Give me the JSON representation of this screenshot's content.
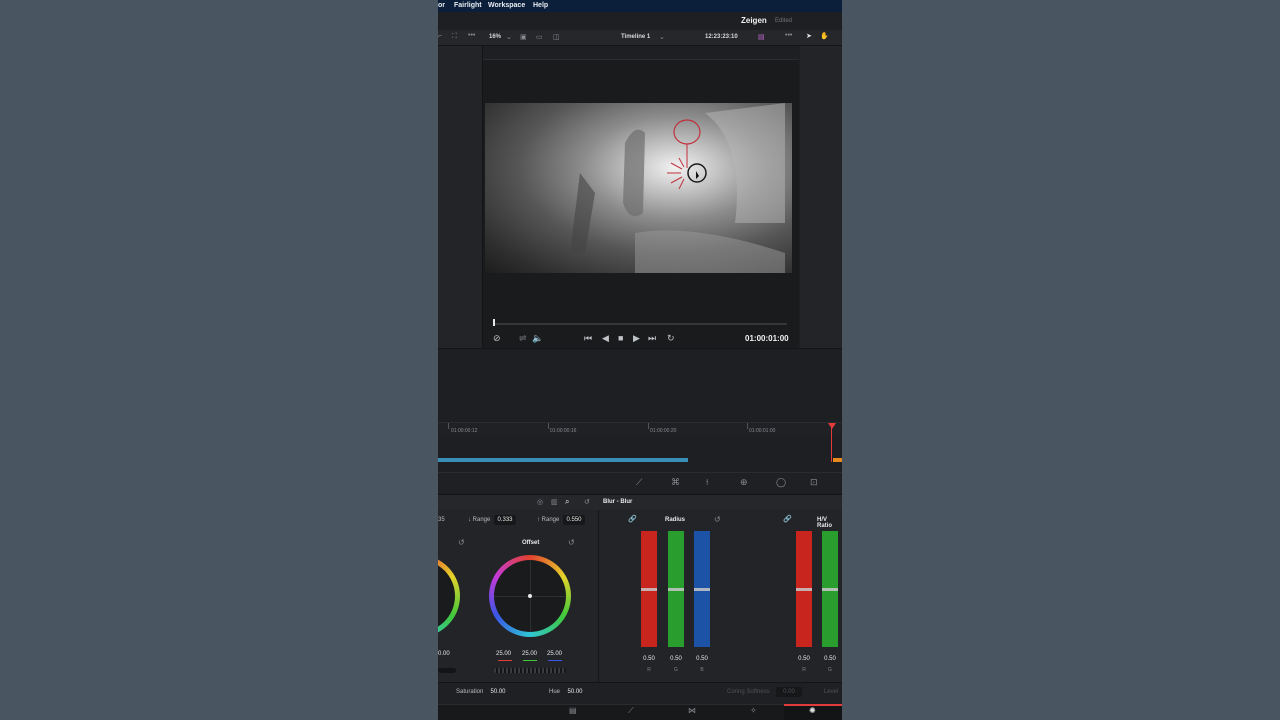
{
  "menu": {
    "items": [
      "or",
      "Fairlight",
      "Workspace",
      "Help"
    ]
  },
  "project": {
    "name": "Zeigen",
    "status": "Edited"
  },
  "toolbar": {
    "zoom": "16%",
    "timeline": "Timeline 1",
    "timecode": "12:23:23:10"
  },
  "viewer": {
    "timecode": "01:00:01:00"
  },
  "ruler": {
    "marks": [
      "01:00:00:12",
      "01:00:00:16",
      "01:00:00:20",
      "01:00:01:00"
    ]
  },
  "node": {
    "title": "Blur - Blur"
  },
  "color": {
    "first_value": "35",
    "low_range_label": "↓ Range",
    "low_range_value": "0.333",
    "high_range_label": "↑ Range",
    "high_range_value": "0.550",
    "offset_label": "Offset",
    "left_wheel_value": "0.00",
    "offset_values": [
      "25.00",
      "25.00",
      "25.00"
    ],
    "saturation_label": "Saturation",
    "saturation_value": "50.00",
    "hue_label": "Hue",
    "hue_value": "50.00"
  },
  "blur": {
    "radius_label": "Radius",
    "hv_label": "H/V Ratio",
    "radius_values": [
      "0.50",
      "0.50",
      "0.50"
    ],
    "hv_values": [
      "0.50",
      "0.50"
    ],
    "channels": [
      "R",
      "G",
      "B"
    ],
    "coring_label": "Coring Softness",
    "coring_value": "0.00",
    "level_label": "Level"
  },
  "colors": {
    "accent_red": "#e23b3b",
    "clip_blue": "#3a8fb7",
    "menubar": "#0b1f3a"
  }
}
